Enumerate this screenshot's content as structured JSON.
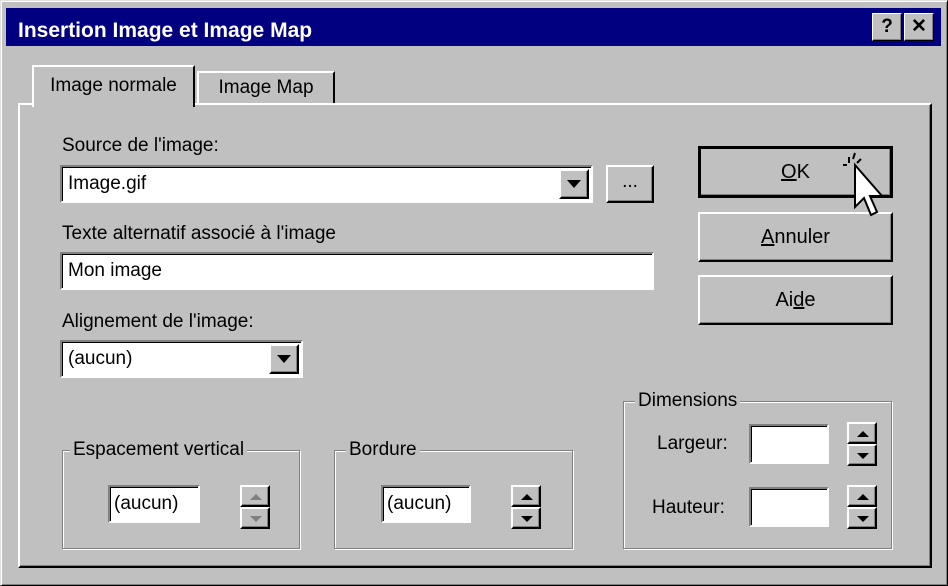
{
  "window": {
    "title": "Insertion Image et Image Map",
    "help_label": "?",
    "close_label": "✕"
  },
  "tabs": [
    {
      "label": "Image normale",
      "active": true
    },
    {
      "label": "Image Map",
      "active": false
    }
  ],
  "source": {
    "label": "Source de l'image:",
    "value": "Image.gif",
    "browse_label": "..."
  },
  "alt_text": {
    "label": "Texte alternatif associé à l'image",
    "value": "Mon image"
  },
  "alignment": {
    "label": "Alignement de l'image:",
    "value": "(aucun)"
  },
  "buttons": {
    "ok": {
      "pre": "",
      "accel": "O",
      "post": "K"
    },
    "cancel": {
      "pre": "",
      "accel": "A",
      "post": "nnuler"
    },
    "help": {
      "pre": "Ai",
      "accel": "d",
      "post": "e"
    }
  },
  "vertical_spacing": {
    "legend": "Espacement vertical",
    "value": "(aucun)",
    "enabled": false
  },
  "border": {
    "legend": "Bordure",
    "value": "(aucun)",
    "enabled": true
  },
  "dimensions": {
    "legend": "Dimensions",
    "width_label": "Largeur:",
    "width_value": "",
    "height_label": "Hauteur:",
    "height_value": ""
  },
  "icons": {
    "cursor": "arrow-cursor-icon",
    "dropdown": "chevron-down-icon"
  }
}
